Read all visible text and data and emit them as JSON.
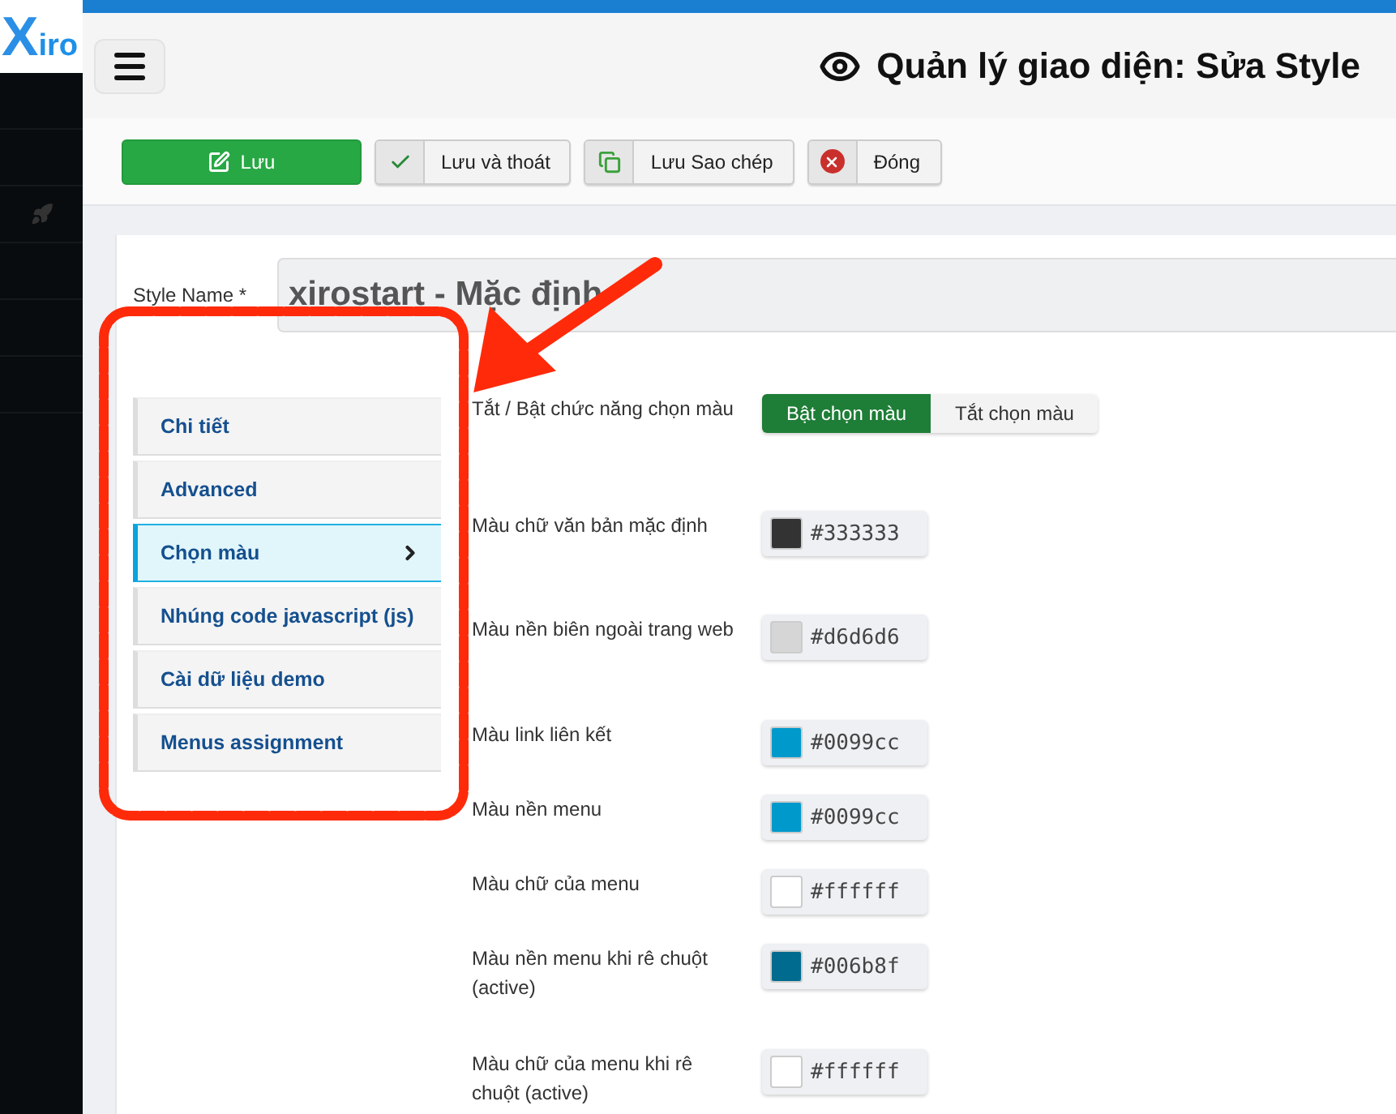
{
  "logo": {
    "text": "Xiro"
  },
  "header": {
    "title": "Quản lý giao diện: Sửa Style"
  },
  "toolbar": [
    {
      "label": "Lưu",
      "kind": "primary"
    },
    {
      "label": "Lưu và thoát",
      "kind": "default"
    },
    {
      "label": "Lưu Sao chép",
      "kind": "default"
    },
    {
      "label": "Đóng",
      "kind": "default"
    }
  ],
  "style_name": {
    "label": "Style Name *",
    "value": "xirostart - Mặc định"
  },
  "tabs": [
    {
      "label": "Chi tiết",
      "selected": false
    },
    {
      "label": "Advanced",
      "selected": false
    },
    {
      "label": "Chọn màu",
      "selected": true
    },
    {
      "label": "Nhúng code javascript (js)",
      "selected": false
    },
    {
      "label": "Cài dữ liệu demo",
      "selected": false
    },
    {
      "label": "Menus assignment",
      "selected": false
    }
  ],
  "fields": [
    {
      "kind": "toggle",
      "label": "Tắt / Bật chức năng chọn màu",
      "options": [
        {
          "label": "Bật chọn màu",
          "selected": true
        },
        {
          "label": "Tắt chọn màu",
          "selected": false
        }
      ]
    },
    {
      "kind": "color",
      "label": "Màu chữ văn bản mặc định",
      "value": "#333333",
      "color": "#333333"
    },
    {
      "kind": "color",
      "label": "Màu nền biên ngoài trang web",
      "value": "#d6d6d6",
      "color": "#d6d6d6"
    },
    {
      "kind": "color",
      "label": "Màu link liên kết",
      "value": "#0099cc",
      "color": "#0099cc"
    },
    {
      "kind": "color",
      "label": "Màu nền menu",
      "value": "#0099cc",
      "color": "#0099cc"
    },
    {
      "kind": "color",
      "label": "Màu chữ của menu",
      "value": "#ffffff",
      "color": "#ffffff"
    },
    {
      "kind": "color",
      "label": "Màu nền menu khi rê chuột (active)",
      "value": "#006b8f",
      "color": "#006b8f"
    },
    {
      "kind": "color",
      "label": "Màu chữ của menu khi rê chuột (active)",
      "value": "#ffffff",
      "color": "#ffffff"
    }
  ]
}
